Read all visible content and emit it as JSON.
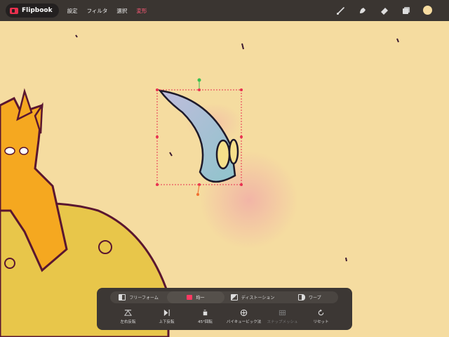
{
  "app": {
    "name": "Flipbook"
  },
  "menu": [
    {
      "label": "設定",
      "active": false
    },
    {
      "label": "フィルタ",
      "active": false
    },
    {
      "label": "選択",
      "active": false
    },
    {
      "label": "変形",
      "active": true
    }
  ],
  "tools": [
    "brush-icon",
    "smudge-icon",
    "eraser-icon",
    "layers-icon"
  ],
  "current_color": "#f7dca0",
  "accent_color": "#ff5a78",
  "transform_panel": {
    "tabs": [
      {
        "label": "フリーフォーム",
        "active": false
      },
      {
        "label": "均一",
        "active": true
      },
      {
        "label": "ディストーション",
        "active": false
      },
      {
        "label": "ワープ",
        "active": false
      }
    ],
    "actions": [
      {
        "label": "左右反転",
        "enabled": true
      },
      {
        "label": "上下反転",
        "enabled": true
      },
      {
        "label": "45°回転",
        "enabled": true
      },
      {
        "label": "バイキュービック法",
        "enabled": true
      },
      {
        "label": "スナップメッシュ",
        "enabled": false
      },
      {
        "label": "リセット",
        "enabled": true
      }
    ]
  }
}
